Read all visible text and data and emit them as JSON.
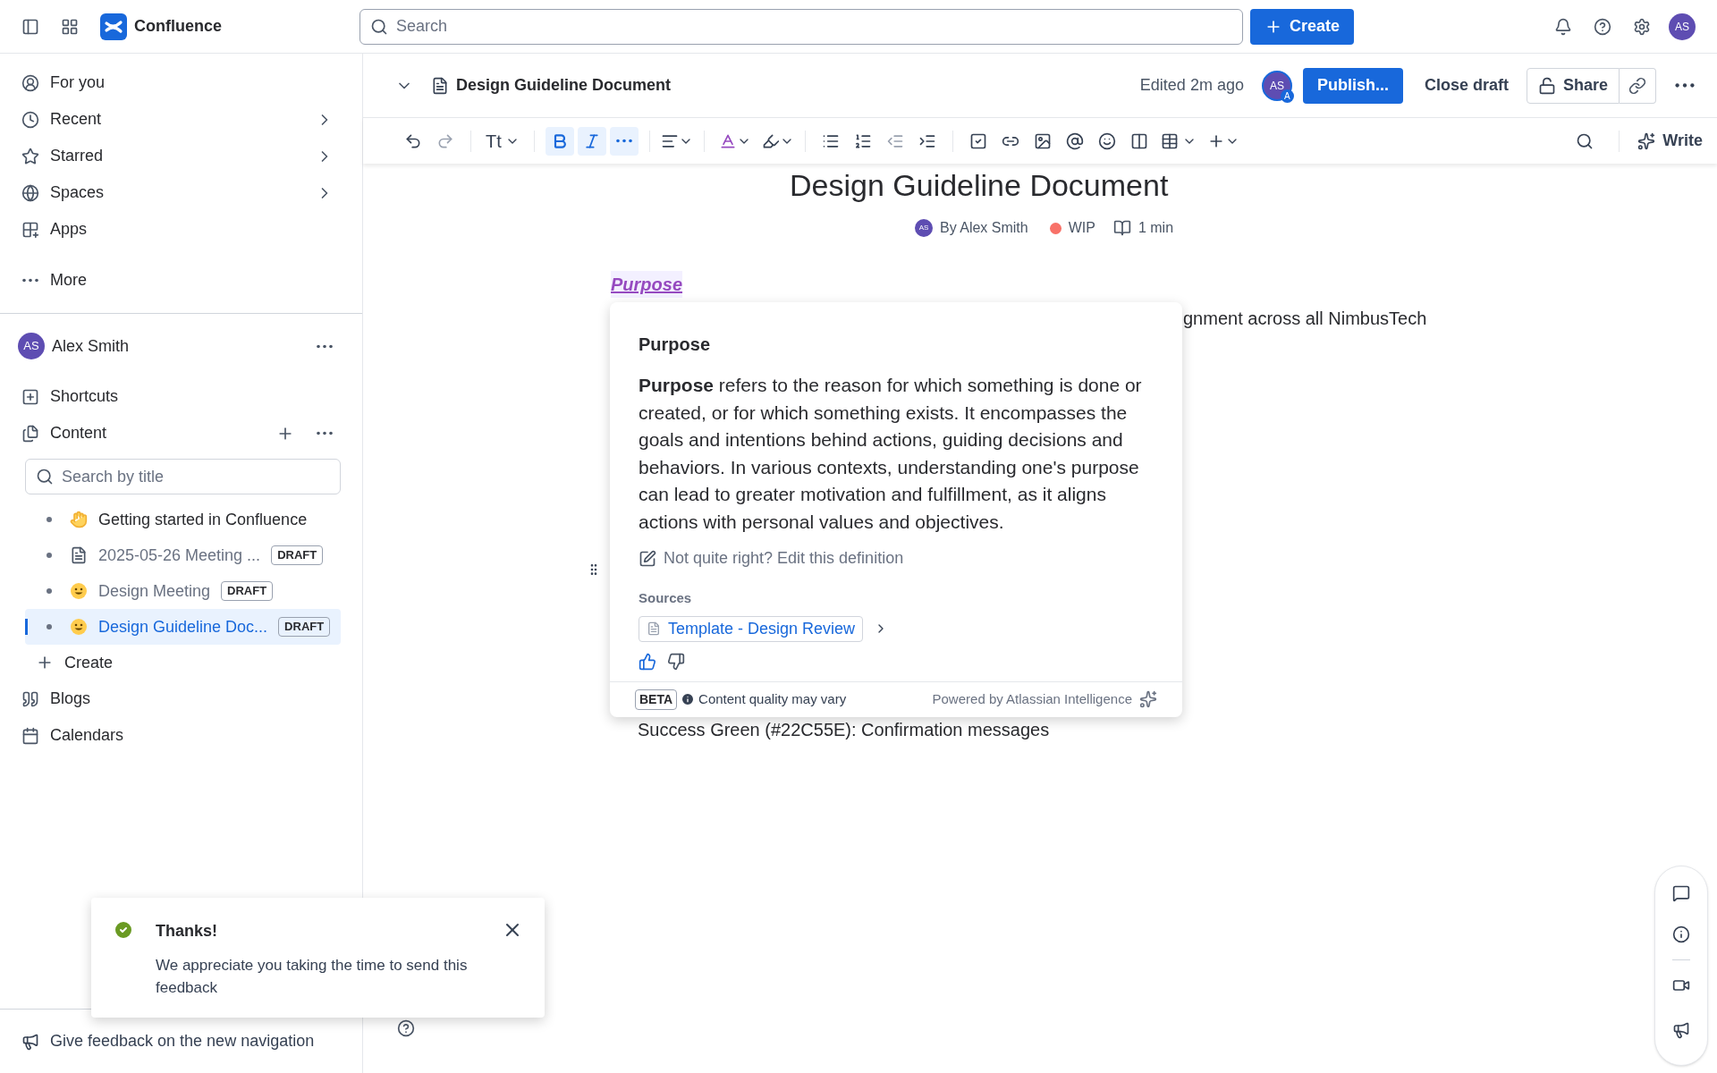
{
  "topbar": {
    "product": "Confluence",
    "search_placeholder": "Search",
    "create_button": "Create",
    "avatar": "AS"
  },
  "sidebar": {
    "nav": [
      {
        "label": "For you",
        "arrow": false
      },
      {
        "label": "Recent",
        "arrow": true
      },
      {
        "label": "Starred",
        "arrow": true
      },
      {
        "label": "Spaces",
        "arrow": true
      },
      {
        "label": "Apps",
        "arrow": false
      }
    ],
    "more": "More",
    "user": {
      "initials": "AS",
      "name": "Alex Smith"
    },
    "shortcuts": "Shortcuts",
    "content": "Content",
    "search_placeholder": "Search by title",
    "tree": [
      {
        "label": "Getting started in Confluence",
        "selected": false
      },
      {
        "label": "2025-05-26 Meeting ...",
        "badge": "DRAFT",
        "selected": false
      },
      {
        "label": "Design Meeting",
        "badge": "DRAFT",
        "selected": false
      },
      {
        "label": "Design Guideline Doc...",
        "badge": "DRAFT",
        "selected": true
      }
    ],
    "create": "Create",
    "links": [
      "Blogs",
      "Calendars"
    ],
    "feedback": "Give feedback on the new navigation"
  },
  "doc_header": {
    "title": "Design Guideline Document",
    "edited": "Edited 2m ago",
    "avatar": "AS",
    "avatar_badge": "A",
    "publish": "Publish...",
    "close": "Close draft",
    "share": "Share"
  },
  "toolbar": {
    "text_style": "Tt",
    "format": [
      {
        "kind": "bold",
        "selected": true
      },
      {
        "kind": "italic",
        "selected": true
      },
      {
        "kind": "more",
        "selected": true
      }
    ],
    "write": "Write"
  },
  "document": {
    "title": "Design Guideline Document",
    "author": "By Alex Smith",
    "author_initials": "AS",
    "status": "WIP",
    "read_time": "1 min",
    "heading": "Purpose",
    "covered_line": "gnment across all NimbusTech",
    "list_item": "Success Green (#22C55E): Confirmation messages"
  },
  "definition": {
    "title": "Purpose",
    "body": "**Purpose** refers to the reason for which something is done or created, or for which something exists. It encompasses the goals and intentions behind actions, guiding decisions and behaviors. In various contexts, understanding one's purpose can lead to greater motivation and fulfillment, as it aligns actions with personal values and objectives.",
    "edit": "Not quite right? Edit this definition",
    "sources_label": "Sources",
    "source": "Template - Design Review",
    "liked": true,
    "beta": "BETA",
    "quality": "Content quality may vary",
    "powered": "Powered by Atlassian Intelligence"
  },
  "toast": {
    "title": "Thanks!",
    "message": "We appreciate you taking the time to send this feedback"
  }
}
